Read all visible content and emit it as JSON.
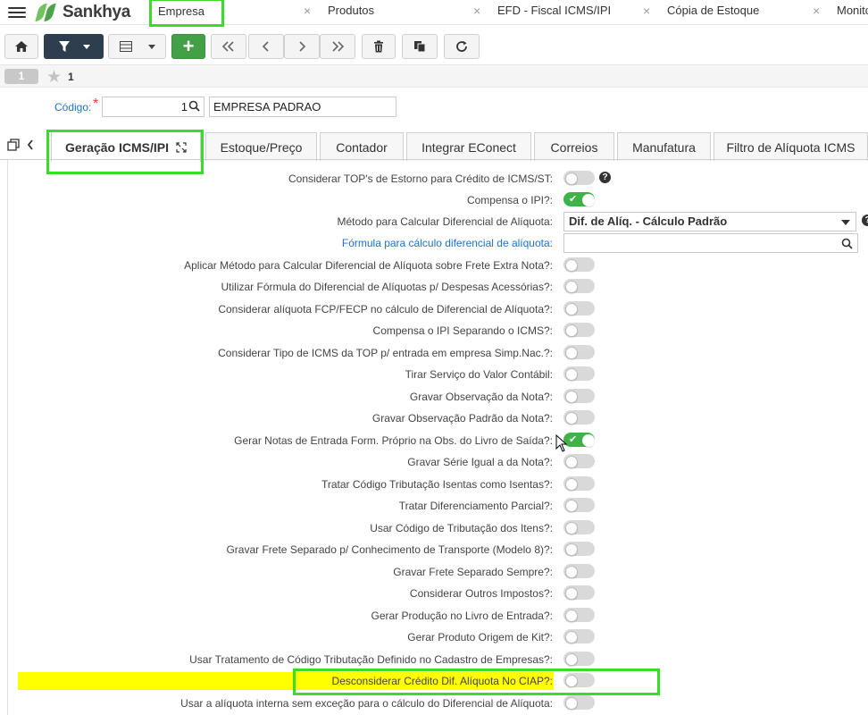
{
  "app": {
    "name": "Sankhya"
  },
  "top_tabs": [
    {
      "label": "Empresa",
      "closable": false,
      "active": true
    },
    {
      "label": "Produtos",
      "closable": true
    },
    {
      "label": "EFD - Fiscal ICMS/IPI",
      "closable": true
    },
    {
      "label": "Cópia de Estoque",
      "closable": true
    },
    {
      "label": "Monito",
      "closable": true
    }
  ],
  "toolbar": {
    "buttons": [
      "home-icon",
      "filter-icon",
      "grid-icon",
      "add-icon",
      "first-icon",
      "previous-icon",
      "next-icon",
      "last-icon",
      "delete-icon",
      "copy-icon",
      "refresh-icon"
    ],
    "add_label": "+"
  },
  "record_bar": {
    "record_number": "1",
    "favorite_count": "1"
  },
  "codigo": {
    "label": "Código:",
    "required_mark": "*",
    "value": "1",
    "description": "EMPRESA PADRAO"
  },
  "form_tabs": [
    {
      "label": "Geração ICMS/IPI",
      "active": true
    },
    {
      "label": "Estoque/Preço"
    },
    {
      "label": "Contador"
    },
    {
      "label": "Integrar EConect"
    },
    {
      "label": "Correios"
    },
    {
      "label": "Manufatura"
    },
    {
      "label": "Filtro de Alíquota ICMS"
    }
  ],
  "fields": [
    {
      "label": "Considerar TOP's de Estorno para Crédito de ICMS/ST:",
      "type": "toggle",
      "value": false,
      "help": "?"
    },
    {
      "label": "Compensa o IPI?:",
      "type": "toggle",
      "value": true
    },
    {
      "label": "Método para Calcular Diferencial de Alíquota:",
      "type": "select",
      "value": "Dif. de Alíq. - Cálculo Padrão",
      "help": "?"
    },
    {
      "label": "Fórmula para cálculo diferencial de alíquota:",
      "type": "search",
      "value": "",
      "link": true
    },
    {
      "label": "Aplicar Método para Calcular Diferencial de Alíquota sobre Frete Extra Nota?:",
      "type": "toggle",
      "value": false
    },
    {
      "label": "Utilizar Fórmula do Diferencial de Alíquotas p/ Despesas Acessórias?:",
      "type": "toggle",
      "value": false
    },
    {
      "label": "Considerar alíquota FCP/FECP no cálculo de Diferencial de Alíquota?:",
      "type": "toggle",
      "value": false
    },
    {
      "label": "Compensa o IPI Separando o ICMS?:",
      "type": "toggle",
      "value": false
    },
    {
      "label": "Considerar Tipo de ICMS da TOP p/ entrada em empresa Simp.Nac.?:",
      "type": "toggle",
      "value": false
    },
    {
      "label": "Tirar Serviço do Valor Contábil:",
      "type": "toggle",
      "value": false
    },
    {
      "label": "Gravar Observação da Nota?:",
      "type": "toggle",
      "value": false
    },
    {
      "label": "Gravar Observação Padrão da Nota?:",
      "type": "toggle",
      "value": false
    },
    {
      "label": "Gerar Notas de Entrada Form. Próprio na Obs. do Livro de Saída?:",
      "type": "toggle",
      "value": true
    },
    {
      "label": "Gravar Série Igual a da Nota?:",
      "type": "toggle",
      "value": false
    },
    {
      "label": "Tratar Código Tributação Isentas como Isentas?:",
      "type": "toggle",
      "value": false
    },
    {
      "label": "Tratar Diferenciamento Parcial?:",
      "type": "toggle",
      "value": false
    },
    {
      "label": "Usar Código de Tributação dos Itens?:",
      "type": "toggle",
      "value": false
    },
    {
      "label": "Gravar Frete Separado p/ Conhecimento de Transporte (Modelo 8)?:",
      "type": "toggle",
      "value": false
    },
    {
      "label": "Gravar Frete Separado Sempre?:",
      "type": "toggle",
      "value": false
    },
    {
      "label": "Considerar Outros Impostos?:",
      "type": "toggle",
      "value": false
    },
    {
      "label": "Gerar Produção no Livro de Entrada?:",
      "type": "toggle",
      "value": false
    },
    {
      "label": "Gerar Produto Origem de Kit?:",
      "type": "toggle",
      "value": false
    },
    {
      "label": "Usar Tratamento de Código Tributação Definido no Cadastro de Empresas?:",
      "type": "toggle",
      "value": false
    },
    {
      "label": "Desconsiderar Crédito Dif. Alíquota No CIAP?:",
      "type": "toggle",
      "value": false,
      "highlighted": true
    },
    {
      "label": "Usar a alíquota interna sem exceção para o cálculo do Diferencial de Alíquota:",
      "type": "toggle",
      "value": false
    }
  ],
  "colors": {
    "highlight_frame": "#3adb2a",
    "highlight_fill": "#ffff00",
    "toggle_on": "#3fb24a",
    "link": "#1a73c9"
  }
}
